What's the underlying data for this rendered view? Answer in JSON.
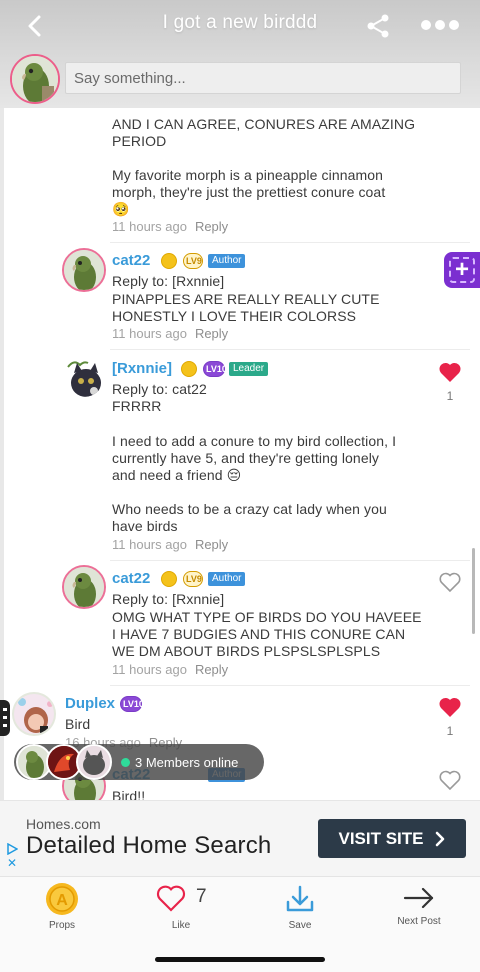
{
  "header": {
    "title": "I got a new birddd",
    "input_placeholder": "Say something..."
  },
  "comments": [
    {
      "text1": "AND I CAN AGREE, CONURES ARE AMAZING\nPERIOD",
      "text2": "My favorite morph is a pineapple cinnamon\nmorph, they're just the prettiest conure coat\n🥺",
      "time": "11 hours ago",
      "reply_label": "Reply"
    },
    {
      "username": "cat22",
      "level": "LV9",
      "role": "Author",
      "reply_to": "Reply to: [Rxnnie]",
      "text": "PINAPPLES ARE REALLY REALLY CUTE\nHONESTLY I LOVE THEIR COLORSS",
      "time": "11 hours ago",
      "reply_label": "Reply"
    },
    {
      "username": "[Rxnnie]",
      "level": "LV10",
      "role": "Leader",
      "reply_to": "Reply to: cat22",
      "text1": "FRRRR",
      "text2": "I need to add a conure to my bird collection, I\ncurrently have 5, and they're getting lonely\nand need a friend 😔",
      "text3": "Who needs to be a crazy cat lady when you\nhave birds",
      "time": "11 hours ago",
      "reply_label": "Reply",
      "likes": "1"
    },
    {
      "username": "cat22",
      "level": "LV9",
      "role": "Author",
      "reply_to": "Reply to: [Rxnnie]",
      "text": "OMG WHAT TYPE OF BIRDS DO YOU HAVEEE\nI HAVE 7 BUDGIES AND THIS CONURE CAN\nWE DM ABOUT BIRDS PLSPSLSPLSPLS",
      "time": "11 hours ago",
      "reply_label": "Reply"
    },
    {
      "username": "Duplex",
      "level": "LV10",
      "text": "Bird",
      "time": "16 hours ago",
      "reply_label": "Reply",
      "likes": "1"
    },
    {
      "username": "cat22",
      "role": "Author",
      "text": "Bird!!"
    }
  ],
  "members_online": "3 Members online",
  "ad": {
    "domain": "Homes.com",
    "headline": "Detailed Home Search",
    "button": "VISIT SITE"
  },
  "bottom_bar": {
    "props": "Props",
    "like": "Like",
    "like_count": "7",
    "save": "Save",
    "next": "Next Post"
  },
  "colors": {
    "accent_blue": "#3a9bd9",
    "heart_red": "#e8234a",
    "fab_purple": "#7b2fd0"
  }
}
